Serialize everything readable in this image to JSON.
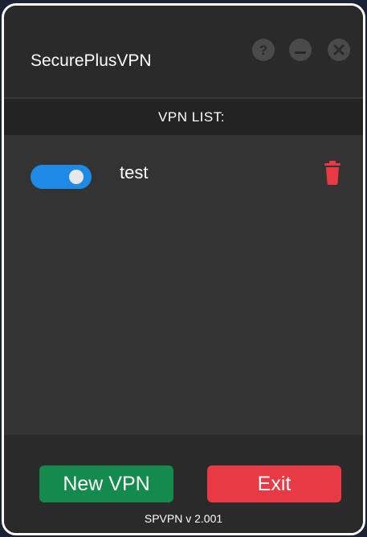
{
  "window": {
    "title": "SecurePlusVPN",
    "controls": {
      "help_icon": "question-icon",
      "minimize_icon": "minimize-icon",
      "close_icon": "close-icon"
    }
  },
  "vpn_list": {
    "title": "VPN LIST:",
    "items": [
      {
        "name": "test",
        "enabled": true,
        "toggle_color": "#1e8ae6"
      }
    ]
  },
  "footer": {
    "new_vpn_label": "New VPN",
    "exit_label": "Exit",
    "version": "SPVPN v 2.001"
  },
  "colors": {
    "background": "#2a2a2a",
    "list_area": "#333333",
    "accent": "#1e8ae6",
    "new_button": "#148a4c",
    "exit_button": "#e83a44",
    "delete_icon": "#e83a44"
  }
}
